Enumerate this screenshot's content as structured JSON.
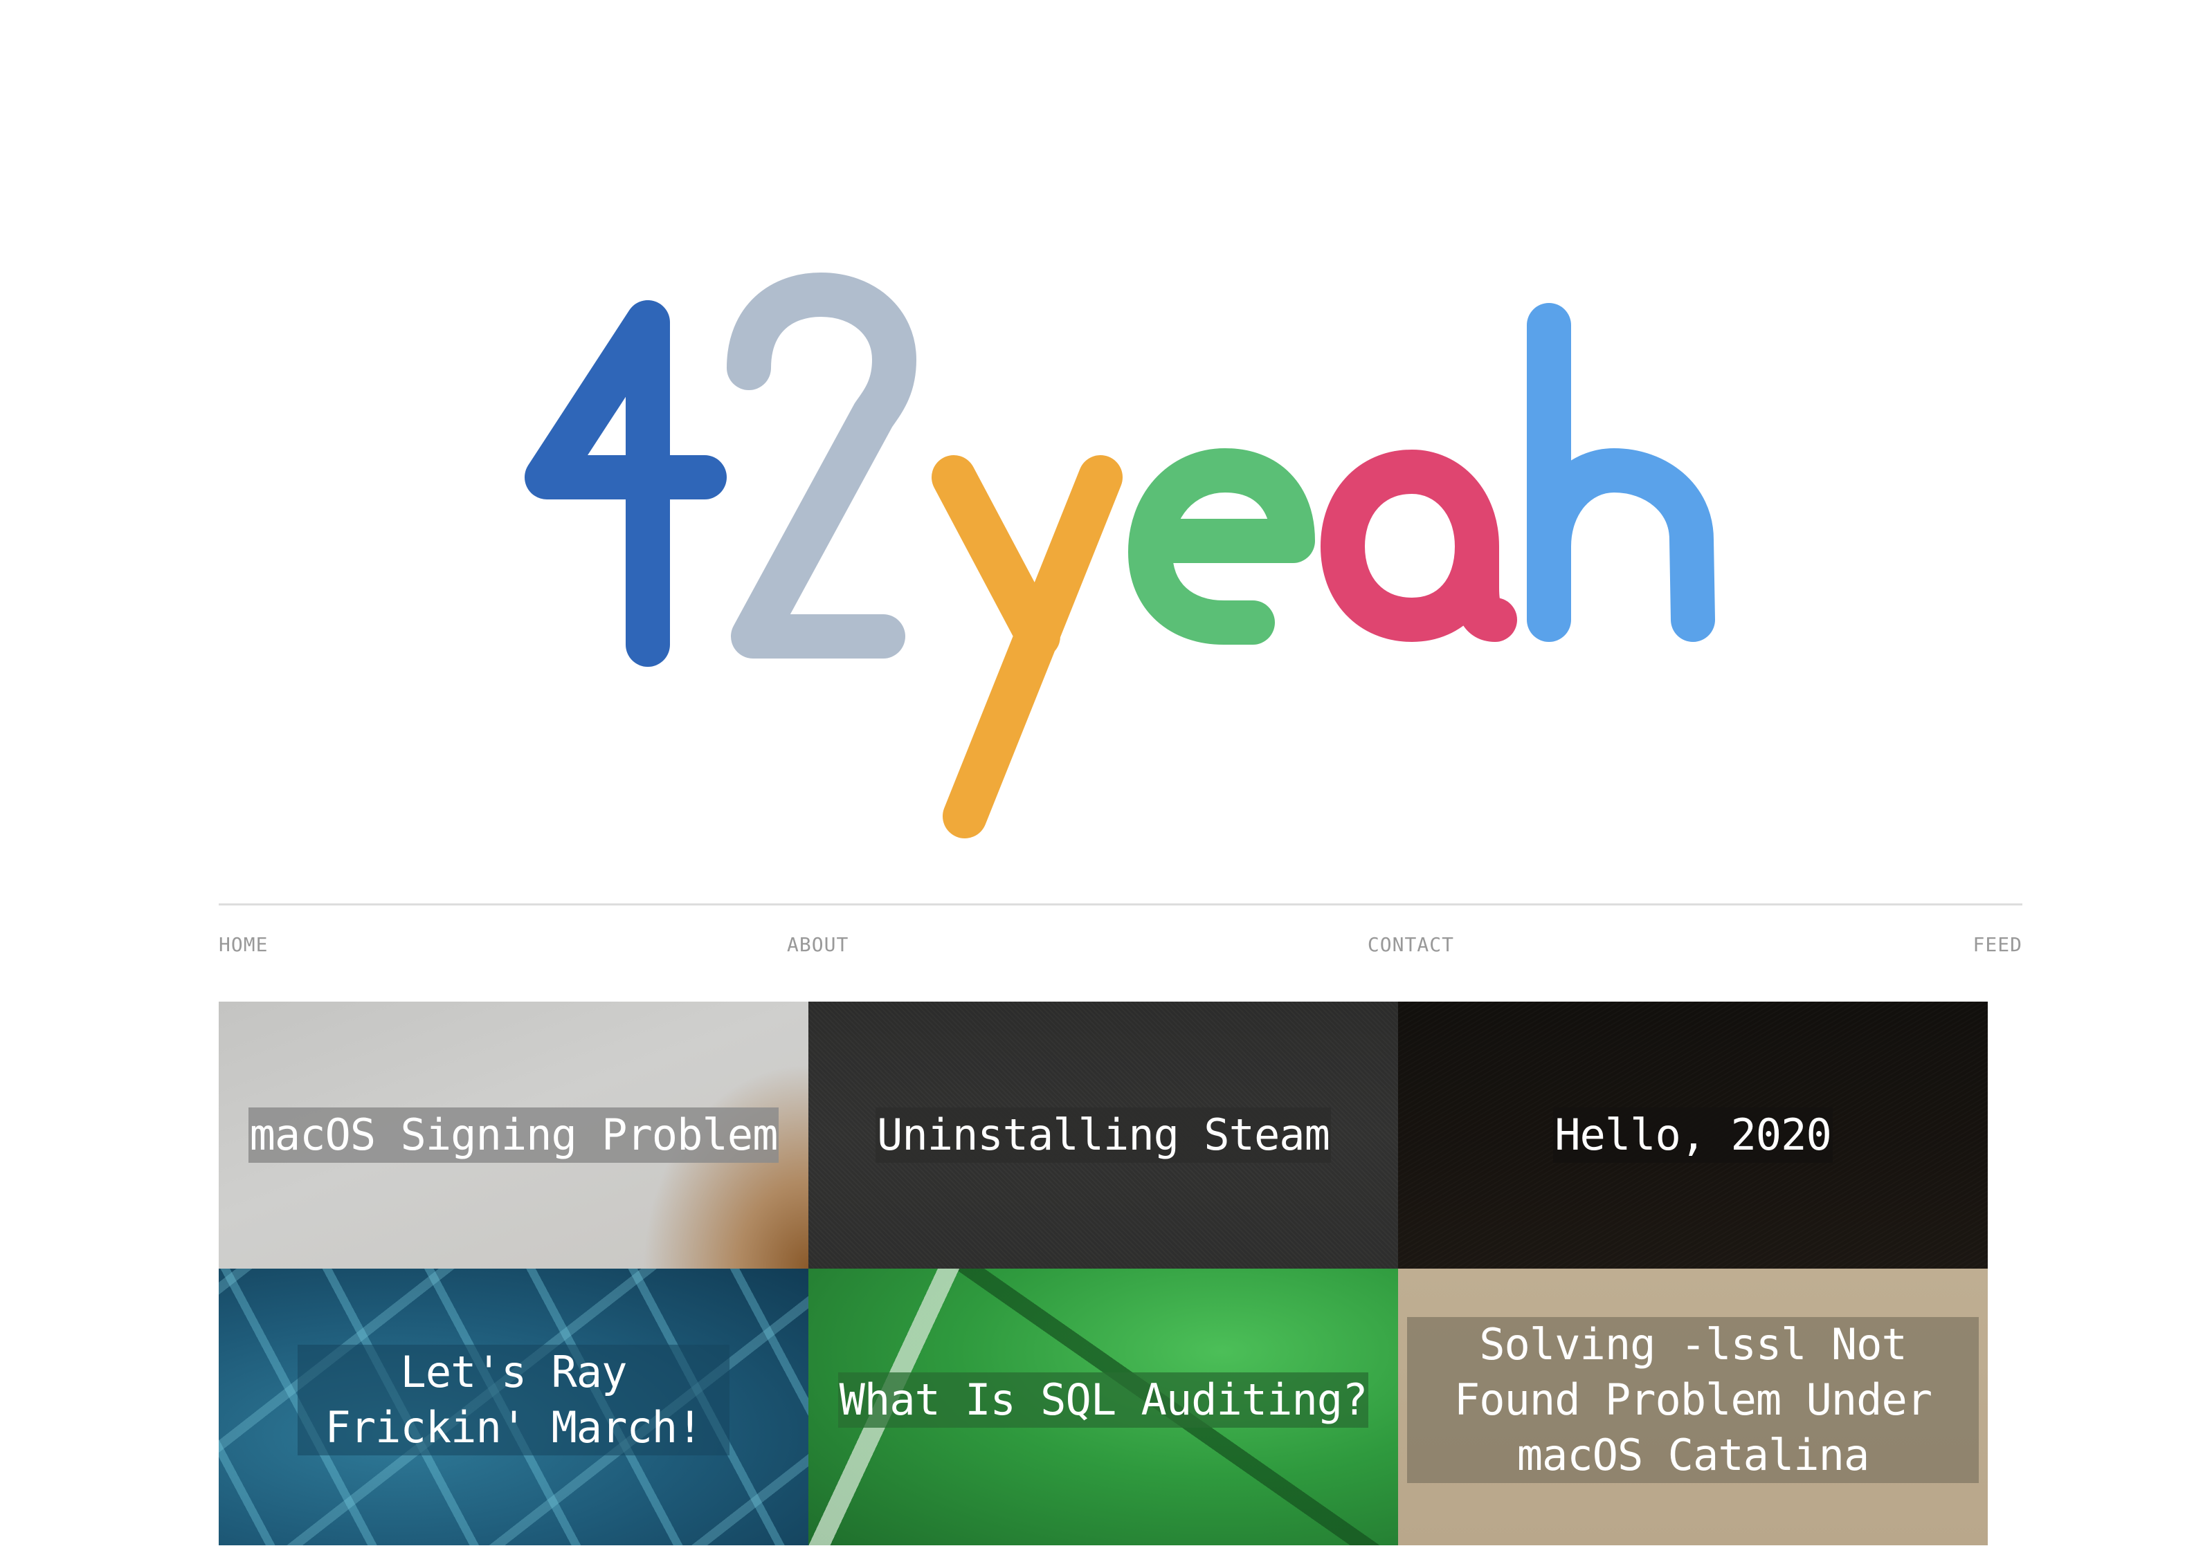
{
  "logo": {
    "text": "42yeah",
    "letters": [
      {
        "char": "4",
        "color": "#2f66b8"
      },
      {
        "char": "2",
        "color": "#b0bdcd"
      },
      {
        "char": "y",
        "color": "#f0a93a"
      },
      {
        "char": "e",
        "color": "#5bbf76"
      },
      {
        "char": "a",
        "color": "#df4570"
      },
      {
        "char": "h",
        "color": "#5aa2ea"
      }
    ]
  },
  "nav": {
    "items": [
      {
        "label": "HOME"
      },
      {
        "label": "ABOUT"
      },
      {
        "label": "CONTACT"
      },
      {
        "label": "FEED"
      }
    ]
  },
  "posts": [
    {
      "title": "macOS Signing Problem"
    },
    {
      "title": "Uninstalling Steam"
    },
    {
      "title": "Hello, 2020"
    },
    {
      "title": "Let's Ray Frickin' March!"
    },
    {
      "title": "What Is SQL Auditing?"
    },
    {
      "title": "Solving -lssl Not Found Problem Under macOS Catalina"
    }
  ]
}
